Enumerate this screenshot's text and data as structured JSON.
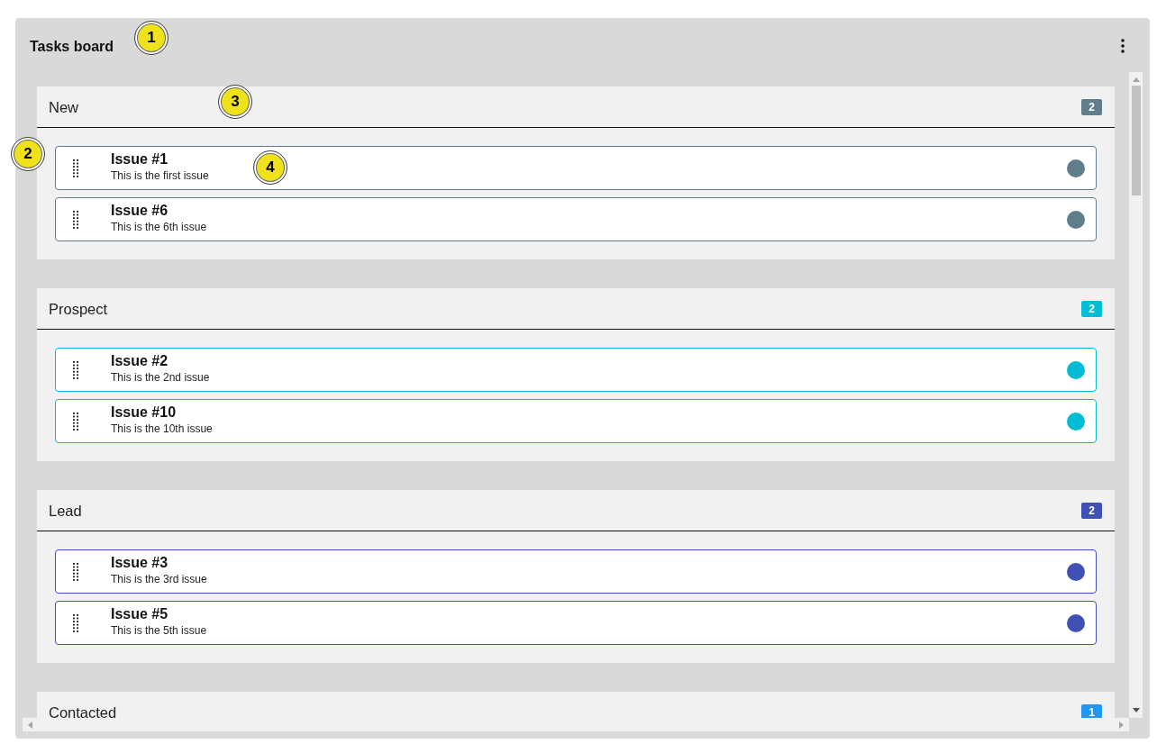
{
  "board": {
    "title": "Tasks board"
  },
  "lanes": [
    {
      "title": "New",
      "count": "2",
      "color": "#607d8b",
      "cards": [
        {
          "title": "Issue #1",
          "description": "This is the first issue"
        },
        {
          "title": "Issue #6",
          "description": "This is the 6th issue"
        }
      ]
    },
    {
      "title": "Prospect",
      "count": "2",
      "color": "#00bcd4",
      "cards": [
        {
          "title": "Issue #2",
          "description": "This is the 2nd issue"
        },
        {
          "title": "Issue #10",
          "description": "This is the 10th issue"
        }
      ]
    },
    {
      "title": "Lead",
      "count": "2",
      "color": "#3f51b5",
      "cards": [
        {
          "title": "Issue #3",
          "description": "This is the 3rd issue"
        },
        {
          "title": "Issue #5",
          "description": "This is the 5th issue"
        }
      ]
    },
    {
      "title": "Contacted",
      "count": "1",
      "color": "#2196f3"
    }
  ],
  "callouts": [
    {
      "label": "1"
    },
    {
      "label": "2"
    },
    {
      "label": "3"
    },
    {
      "label": "4"
    }
  ]
}
